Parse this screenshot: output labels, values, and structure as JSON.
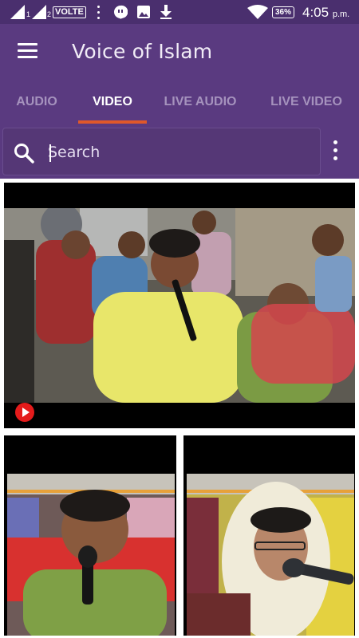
{
  "status_bar": {
    "network_label": "VOLTE",
    "sim1": "1",
    "sim2": "2",
    "battery": "36%",
    "time": "4:05",
    "time_suffix": "p.m."
  },
  "app_bar": {
    "title": "Voice of Islam"
  },
  "tabs": [
    {
      "label": "AUDIO",
      "active": false
    },
    {
      "label": "VIDEO",
      "active": true
    },
    {
      "label": "LIVE AUDIO",
      "active": false
    },
    {
      "label": "LIVE VIDEO",
      "active": false
    }
  ],
  "search": {
    "placeholder": "Search",
    "value": ""
  },
  "colors": {
    "primary": "#5a3a80",
    "status_bar": "#4a2f6e",
    "tab_indicator": "#e0582a",
    "youtube_red": "#e41b1b"
  },
  "videos": [
    {
      "source_icon": "youtube-icon"
    },
    {
      "source_icon": ""
    },
    {
      "source_icon": ""
    }
  ]
}
